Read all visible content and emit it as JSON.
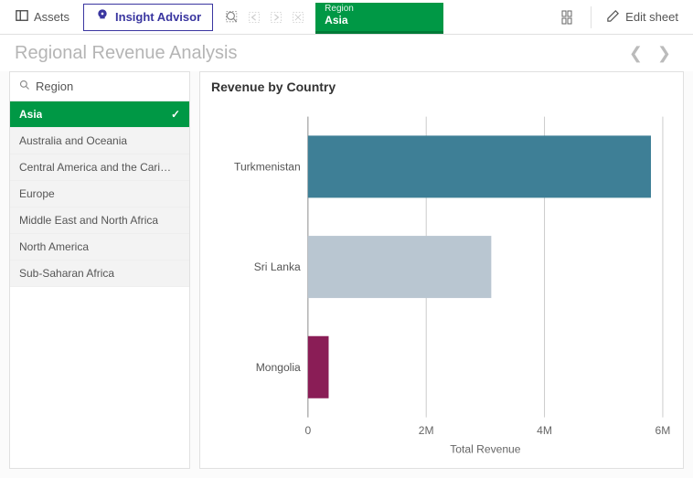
{
  "toolbar": {
    "assets_label": "Assets",
    "insight_label": "Insight Advisor",
    "edit_label": "Edit sheet",
    "filter_chip": {
      "field": "Region",
      "value": "Asia",
      "color": "#009845"
    }
  },
  "page": {
    "title": "Regional Revenue Analysis"
  },
  "filter_pane": {
    "field_label": "Region",
    "items": [
      {
        "label": "Asia",
        "selected": true
      },
      {
        "label": "Australia and Oceania",
        "selected": false
      },
      {
        "label": "Central America and the Carib…",
        "selected": false
      },
      {
        "label": "Europe",
        "selected": false
      },
      {
        "label": "Middle East and North Africa",
        "selected": false
      },
      {
        "label": "North America",
        "selected": false
      },
      {
        "label": "Sub-Saharan Africa",
        "selected": false
      }
    ]
  },
  "chart_data": {
    "type": "bar",
    "orientation": "horizontal",
    "title": "Revenue by Country",
    "categories": [
      "Turkmenistan",
      "Sri Lanka",
      "Mongolia"
    ],
    "values": [
      5800000,
      3100000,
      350000
    ],
    "colors": [
      "#3e7f96",
      "#b9c6d1",
      "#8a1d56"
    ],
    "xlabel": "Total Revenue",
    "xlim": [
      0,
      6000000
    ],
    "xticks": [
      0,
      2000000,
      4000000,
      6000000
    ],
    "xticklabels": [
      "0",
      "2M",
      "4M",
      "6M"
    ],
    "ylabel": "",
    "grid": true
  }
}
